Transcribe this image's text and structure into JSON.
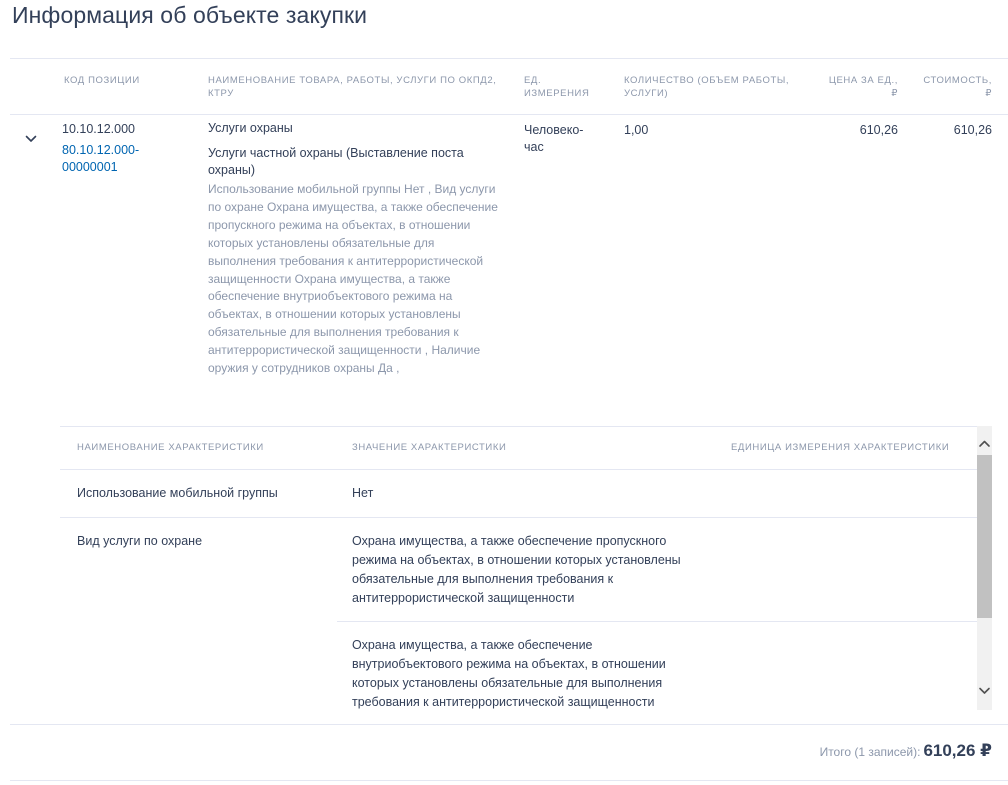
{
  "title": "Информация об объекте закупки",
  "columns": {
    "code": "КОД ПОЗИЦИИ",
    "name_l1": "НАИМЕНОВАНИЕ ТОВАРА, РАБОТЫ, УСЛУГИ ПО ОКПД2,",
    "name_l2": "КТРУ",
    "unit_l1": "ЕД.",
    "unit_l2": "ИЗМЕРЕНИЯ",
    "qty_l1": "КОЛИЧЕСТВО (ОБЪЕМ РАБОТЫ,",
    "qty_l2": "УСЛУГИ)",
    "price_l1": "ЦЕНА ЗА ЕД.,",
    "price_l2": "₽",
    "cost_l1": "СТОИМОСТЬ,",
    "cost_l2": "₽"
  },
  "row": {
    "code": "10.10.12.000",
    "ktru_l1": "80.10.12.000-",
    "ktru_l2": "00000001",
    "name": "Услуги охраны",
    "subname_l1": "Услуги частной охраны (Выставление поста",
    "subname_l2": "охраны)",
    "description_lines": [
      "Использование мобильной группы Нет , Вид услуги",
      "по охране Охрана имущества, а также обеспечение",
      "пропускного режима на объектах, в отношении",
      "которых установлены обязательные для",
      "выполнения требования к антитеррористической",
      "защищенности Охрана имущества, а также",
      "обеспечение внутриобъектового режима на",
      "объектах, в отношении которых установлены",
      "обязательные для выполнения требования к",
      "антитеррористической защищенности , Наличие",
      "оружия у сотрудников охраны Да ,"
    ],
    "unit_l1": "Человеко-",
    "unit_l2": "час",
    "quantity": "1,00",
    "price": "610,26",
    "cost": "610,26"
  },
  "characteristics": {
    "headers": {
      "name": "НАИМЕНОВАНИЕ ХАРАКТЕРИСТИКИ",
      "value": "ЗНАЧЕНИЕ ХАРАКТЕРИСТИКИ",
      "unit": "ЕДИНИЦА ИЗМЕРЕНИЯ ХАРАКТЕРИСТИКИ"
    },
    "rows": [
      {
        "name": "Использование мобильной группы",
        "values": [
          [
            "Нет"
          ]
        ]
      },
      {
        "name": "Вид услуги по охране",
        "values": [
          [
            "Охрана имущества, а также обеспечение пропускного",
            "режима на объектах, в отношении которых установлены",
            "обязательные для выполнения требования к",
            "антитеррористической защищенности"
          ],
          [
            "Охрана имущества, а также обеспечение",
            "внутриобъектового режима на объектах, в отношении",
            "которых установлены обязательные для выполнения",
            "требования к антитеррористической защищенности"
          ]
        ]
      }
    ]
  },
  "footer": {
    "total_label": "Итого (1 записей):",
    "total_value": "610,26 ₽"
  },
  "icons": {
    "expand": "chevron-down-icon",
    "scroll_up": "scroll-up-icon",
    "scroll_down": "scroll-down-icon"
  }
}
